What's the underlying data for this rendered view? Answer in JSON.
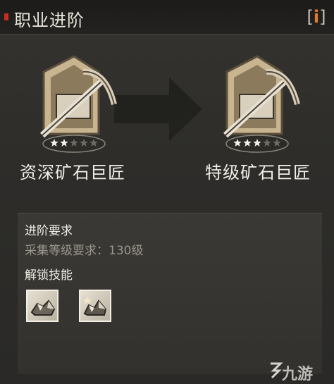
{
  "header": {
    "title": "职业进阶",
    "info_icon": "info-icon"
  },
  "progression": {
    "from_job": "资深矿石巨匠",
    "to_job": "特级矿石巨匠",
    "from_stars": 2,
    "to_stars": 3,
    "star_total": 5
  },
  "requirements": {
    "title": "进阶要求",
    "line": "采集等级要求：130级"
  },
  "skills": {
    "title": "解锁技能",
    "items": [
      {
        "icon": "ore-pile-icon"
      },
      {
        "icon": "ore-pile-stars-icon"
      }
    ]
  },
  "watermark": {
    "text": "九游"
  },
  "colors": {
    "accent": "#c2301f",
    "info": "#e07a2b",
    "badge": "#c9b490"
  }
}
